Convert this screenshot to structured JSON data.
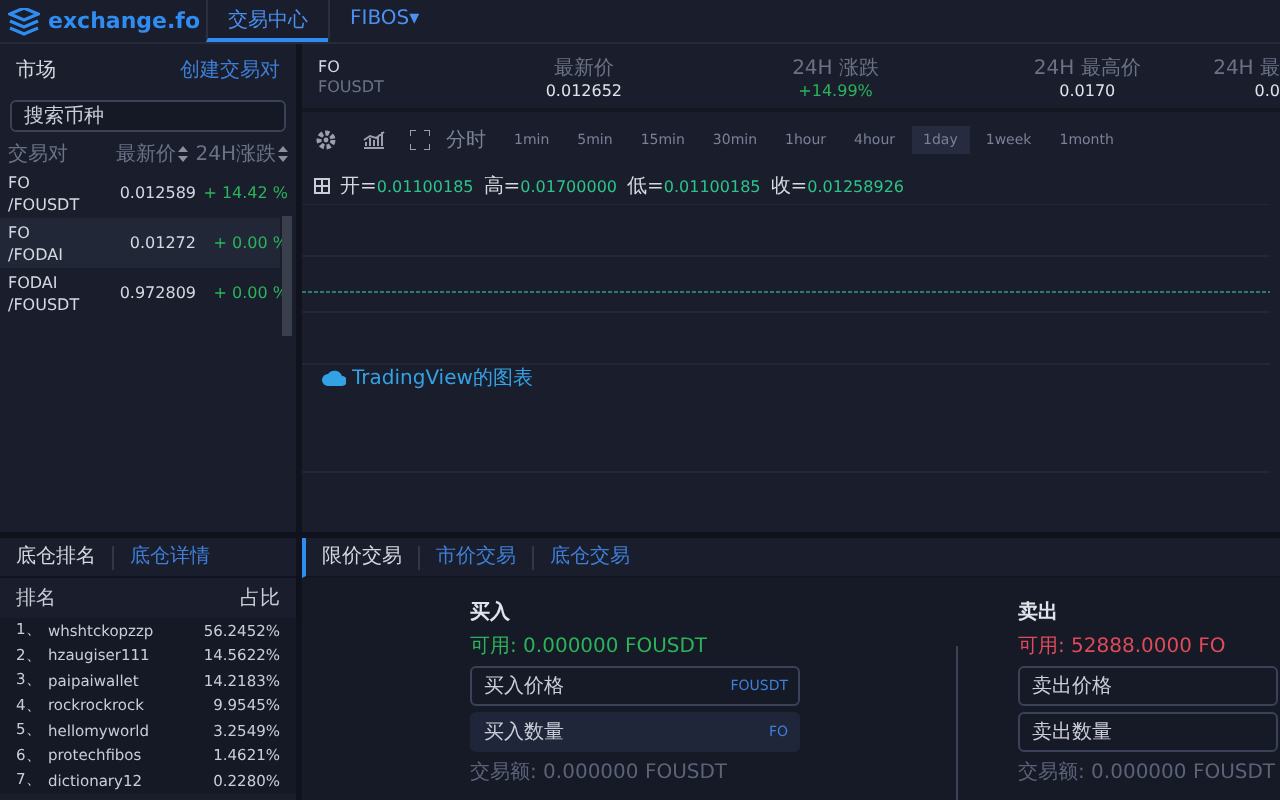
{
  "header": {
    "logo": "exchange.fo",
    "nav": [
      {
        "label": "交易中心",
        "selected": true
      },
      {
        "label": "FIBOS▾",
        "selected": false
      }
    ]
  },
  "market": {
    "title": "市场",
    "create_link": "创建交易对",
    "search": {
      "placeholder": "搜索币种"
    },
    "columns": [
      {
        "label": "交易对",
        "sortable": false
      },
      {
        "label": "最新价",
        "sortable": true
      },
      {
        "label": "24H涨跌",
        "sortable": true
      }
    ],
    "rows": [
      {
        "base": "FO",
        "quote": "/FOUSDT",
        "price": "0.012589",
        "change": "+ 14.42 %",
        "selected": false
      },
      {
        "base": "FO",
        "quote": "/FODAI",
        "price": "0.01272",
        "change": "+ 0.00 %",
        "selected": true
      },
      {
        "base": "FODAI",
        "quote": "/FOUSDT",
        "price": "0.972809",
        "change": "+ 0.00 %",
        "selected": false
      }
    ]
  },
  "ticker": {
    "base": "FO",
    "quote": "FOUSDT",
    "stats": [
      {
        "label": "最新价",
        "value": "0.012652",
        "positive": false
      },
      {
        "label": "24H 涨跌",
        "value": "+14.99%",
        "positive": true
      },
      {
        "label": "24H 最高价",
        "value": "0.0170",
        "positive": false
      },
      {
        "label": "24H 最",
        "value": "0.0",
        "positive": false
      }
    ]
  },
  "chart": {
    "intervals": [
      {
        "label": "分时",
        "selected": false
      },
      {
        "label": "1min",
        "selected": false
      },
      {
        "label": "5min",
        "selected": false
      },
      {
        "label": "15min",
        "selected": false
      },
      {
        "label": "30min",
        "selected": false
      },
      {
        "label": "1hour",
        "selected": false
      },
      {
        "label": "4hour",
        "selected": false
      },
      {
        "label": "1day",
        "selected": true
      },
      {
        "label": "1week",
        "selected": false
      },
      {
        "label": "1month",
        "selected": false
      }
    ],
    "ohlc": [
      {
        "label": "开=",
        "value": "0.01100185"
      },
      {
        "label": "高=",
        "value": "0.01700000"
      },
      {
        "label": "低=",
        "value": "0.01100185"
      },
      {
        "label": "收=",
        "value": "0.01258926"
      }
    ],
    "attribution": "TradingView的图表"
  },
  "positions": {
    "tabs": [
      {
        "label": "底仓排名",
        "selected": true
      },
      {
        "label": "底仓详情",
        "selected": false
      }
    ],
    "columns": [
      "排名",
      "占比"
    ],
    "rows": [
      {
        "rank": "1、",
        "name": "whshtckopzzp",
        "share": "56.2452%"
      },
      {
        "rank": "2、",
        "name": "hzaugiser111",
        "share": "14.5622%"
      },
      {
        "rank": "3、",
        "name": "paipaiwallet",
        "share": "14.2183%"
      },
      {
        "rank": "4、",
        "name": "rockrockrock",
        "share": "9.9545%"
      },
      {
        "rank": "5、",
        "name": "hellomyworld",
        "share": "3.2549%"
      },
      {
        "rank": "6、",
        "name": "protechfibos",
        "share": "1.4621%"
      },
      {
        "rank": "7、",
        "name": "dictionary12",
        "share": "0.2280%"
      }
    ]
  },
  "trade": {
    "tabs": [
      {
        "label": "限价交易",
        "selected": true
      },
      {
        "label": "市价交易",
        "selected": false
      },
      {
        "label": "底仓交易",
        "selected": false
      }
    ],
    "sides": [
      {
        "kind": "buy",
        "title": "买入",
        "available": "可用: 0.000000 FOUSDT",
        "fields": [
          {
            "placeholder": "买入价格",
            "unit": "FOUSDT",
            "focused": false
          },
          {
            "placeholder": "买入数量",
            "unit": "FO",
            "focused": true
          }
        ],
        "total": "交易额: 0.000000 FOUSDT"
      },
      {
        "kind": "sell",
        "title": "卖出",
        "available": "可用: 52888.0000 FO",
        "fields": [
          {
            "placeholder": "卖出价格",
            "focused": false
          },
          {
            "placeholder": "卖出数量",
            "focused": false
          }
        ],
        "total": "交易额: 0.000000 FOUSDT"
      }
    ]
  }
}
